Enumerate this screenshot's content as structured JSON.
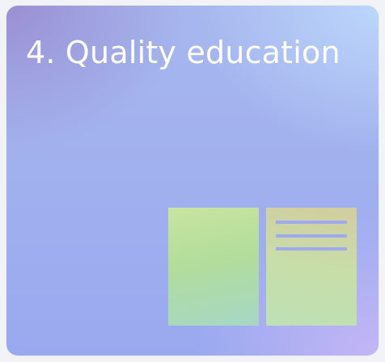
{
  "card": {
    "title": "4. Quality education",
    "icon": "open-book-icon"
  },
  "colors": {
    "title_text": "#ffffff",
    "book_lines": "#9fa9ee",
    "gradient_top_left": "#9a8fd3",
    "gradient_top_right": "#bcd6fb",
    "gradient_bottom_right": "#c4b6f6",
    "page_green": "#b2dd9b"
  }
}
